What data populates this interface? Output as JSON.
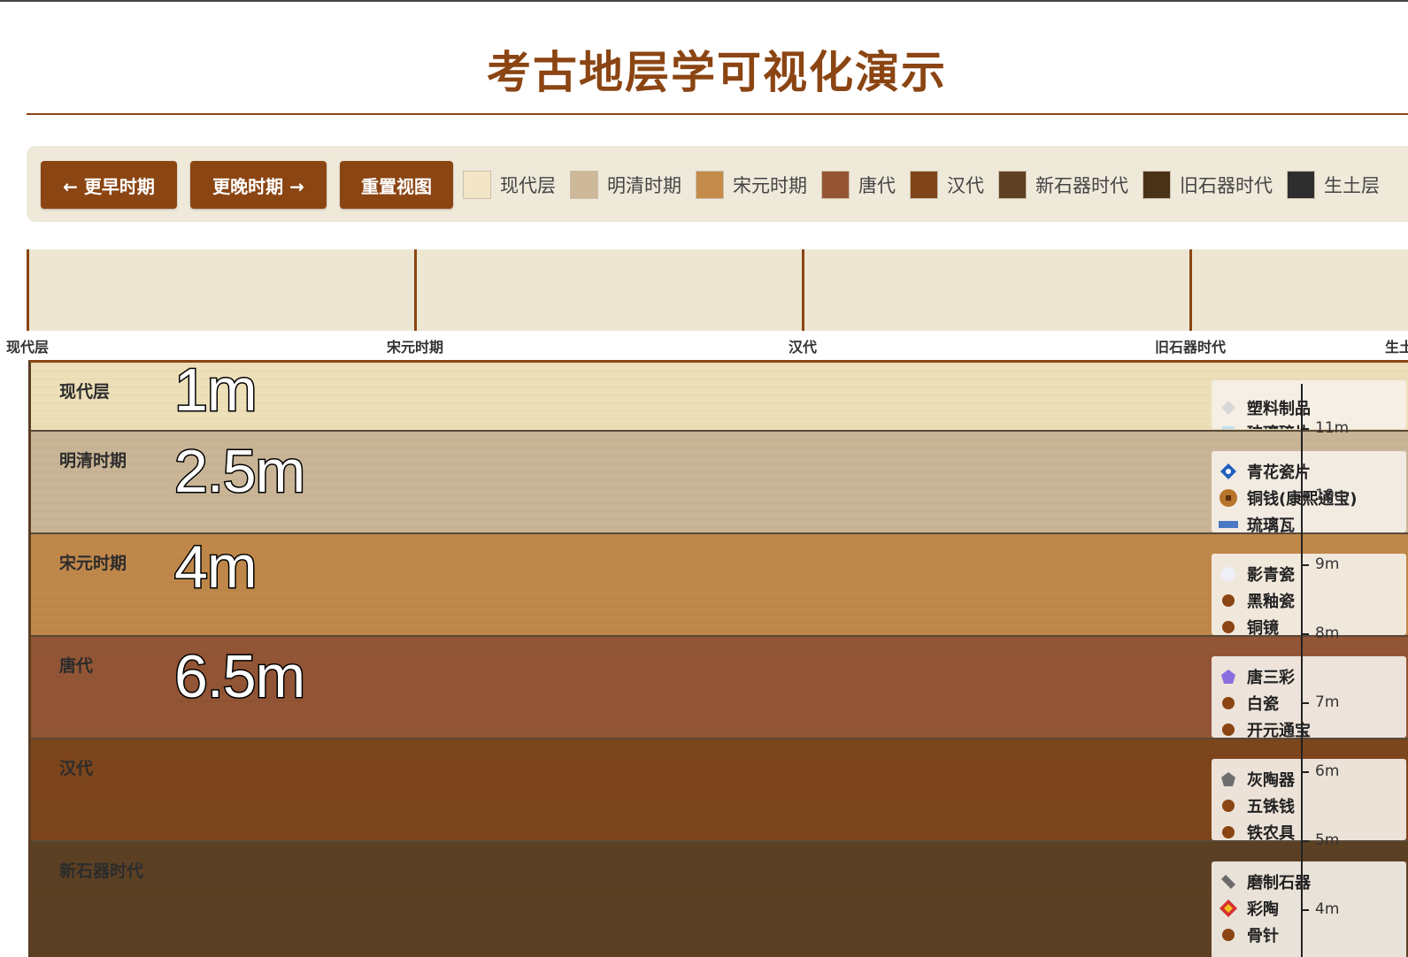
{
  "title": "考古地层学可视化演示",
  "controls": {
    "earlier_label": "← 更早时期",
    "later_label": "更晚时期 →",
    "reset_label": "重置视图"
  },
  "legend": [
    {
      "label": "现代层",
      "color": "#f2e6c6"
    },
    {
      "label": "明清时期",
      "color": "#cdb899"
    },
    {
      "label": "宋元时期",
      "color": "#c48b4b"
    },
    {
      "label": "唐代",
      "color": "#955535"
    },
    {
      "label": "汉代",
      "color": "#7f4419"
    },
    {
      "label": "新石器时代",
      "color": "#5e4023"
    },
    {
      "label": "旧石器时代",
      "color": "#4a3218"
    },
    {
      "label": "生土层",
      "color": "#2e2e2e"
    }
  ],
  "timeline": {
    "labels": [
      "现代层",
      "宋元时期",
      "汉代",
      "旧石器时代",
      "生土"
    ]
  },
  "layers": [
    {
      "name": "现代层",
      "color": "#ede0b8",
      "depth": "1m",
      "artifacts": [
        "塑料制品",
        "玻璃碎片"
      ]
    },
    {
      "name": "明清时期",
      "color": "#c9b596",
      "depth": "2.5m",
      "artifacts": [
        "青花瓷片",
        "铜钱(康熙通宝)",
        "琉璃瓦"
      ]
    },
    {
      "name": "宋元时期",
      "color": "#bf884a",
      "depth": "4m",
      "artifacts": [
        "影青瓷",
        "黑釉瓷",
        "铜镜"
      ]
    },
    {
      "name": "唐代",
      "color": "#925535",
      "depth": "6.5m",
      "artifacts": [
        "唐三彩",
        "白瓷",
        "开元通宝"
      ]
    },
    {
      "name": "汉代",
      "color": "#7d451b",
      "depth": "",
      "artifacts": [
        "灰陶器",
        "五铢钱",
        "铁农具"
      ]
    },
    {
      "name": "新石器时代",
      "color": "#5c4024",
      "depth": "",
      "artifacts": [
        "磨制石器",
        "彩陶",
        "骨针"
      ]
    }
  ],
  "scale": {
    "labels": [
      "11m",
      "10m",
      "9m",
      "8m",
      "7m",
      "6m",
      "5m",
      "4m"
    ]
  }
}
